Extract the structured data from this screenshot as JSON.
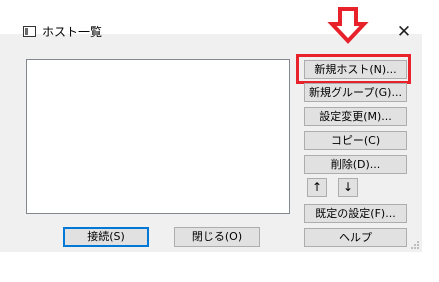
{
  "window": {
    "title": "ホスト一覧",
    "close_glyph": "✕"
  },
  "annotation": {
    "arrow_color": "#e8222a",
    "highlight_color": "#e8222a",
    "highlight_target": "new-host-button"
  },
  "side_buttons": {
    "new_host": "新規ホスト(N)...",
    "new_group": "新規グループ(G)...",
    "change_settings": "設定変更(M)...",
    "copy": "コピー(C)",
    "delete": "削除(D)...",
    "move_up": "↑",
    "move_down": "↓",
    "default_settings": "既定の設定(F)...",
    "help": "ヘルプ"
  },
  "bottom_buttons": {
    "connect": "接続(S)",
    "close": "閉じる(O)"
  },
  "host_list": {
    "items": []
  },
  "colors": {
    "dialog_bg": "#f0f0f0",
    "button_bg": "#e1e1e1",
    "default_button_border": "#0078d7"
  }
}
